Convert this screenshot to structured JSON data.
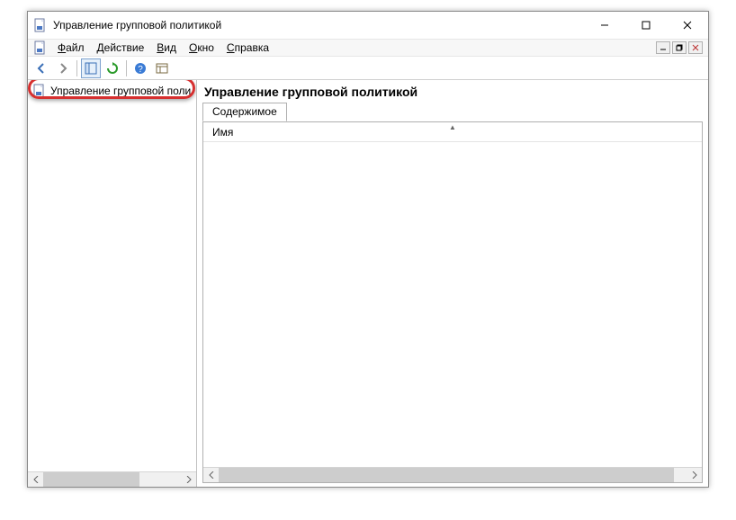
{
  "window": {
    "title": "Управление групповой политикой"
  },
  "menu": {
    "file": "Файл",
    "action": "Действие",
    "view": "Вид",
    "window": "Окно",
    "help": "Справка"
  },
  "tree": {
    "root": "Управление групповой поли"
  },
  "content": {
    "title": "Управление групповой политикой",
    "tab": "Содержимое",
    "column_name": "Имя"
  }
}
